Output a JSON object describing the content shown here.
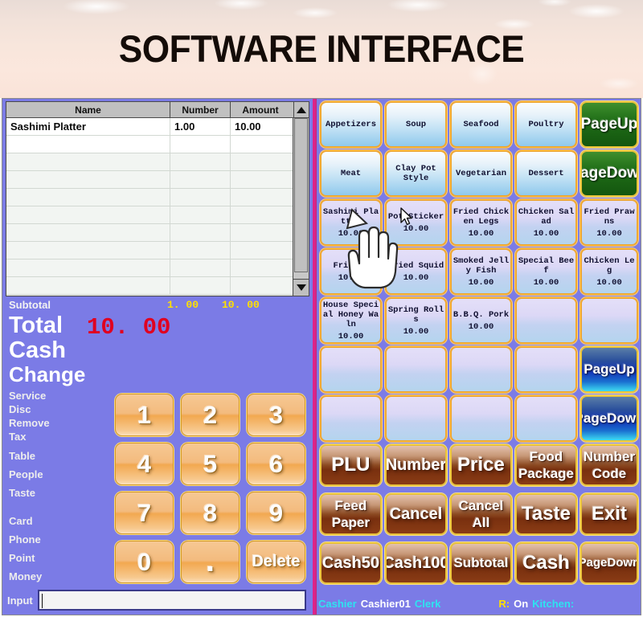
{
  "banner": {
    "title": "SOFTWARE INTERFACE"
  },
  "order_table": {
    "columns": [
      "Name",
      "Number",
      "Amount"
    ],
    "rows": [
      {
        "name": "Sashimi Platter",
        "number": "1.00",
        "amount": "10.00"
      }
    ],
    "empty_row_count": 10
  },
  "totals": {
    "subtotal_label": "Subtotal",
    "subtotal_qty": "1. 00",
    "subtotal_amount": "10. 00",
    "total_label": "Total",
    "total_value": "10. 00",
    "cash_label": "Cash",
    "cash_value": "",
    "change_label": "Change",
    "change_value": ""
  },
  "fields": [
    {
      "label": "Service",
      "value": ""
    },
    {
      "label": "Disc",
      "value": ""
    },
    {
      "label": "Remove",
      "value": ""
    },
    {
      "label": "Tax",
      "value": ""
    },
    {
      "label": "Table",
      "value": ""
    },
    {
      "label": "People",
      "value": ""
    },
    {
      "label": "Taste",
      "value": ""
    },
    {
      "label": "Card",
      "value": ""
    },
    {
      "label": "Phone",
      "value": ""
    },
    {
      "label": "Point",
      "value": ""
    },
    {
      "label": "Money",
      "value": ""
    }
  ],
  "keypad": {
    "keys": [
      "1",
      "2",
      "3",
      "4",
      "5",
      "6",
      "7",
      "8",
      "9",
      "0",
      ".",
      "Delete"
    ]
  },
  "input": {
    "label": "Input",
    "value": "",
    "placeholder": ""
  },
  "categories": [
    {
      "label": "Appetizers"
    },
    {
      "label": "Soup"
    },
    {
      "label": "Seafood"
    },
    {
      "label": "Poultry"
    },
    {
      "label": "Meat"
    },
    {
      "label": "Clay Pot Style"
    },
    {
      "label": "Vegetarian"
    },
    {
      "label": "Dessert"
    }
  ],
  "category_nav": {
    "page_up": "PageUp",
    "page_down": "PageDown"
  },
  "menu_items": [
    {
      "name": "Sashimi Platter",
      "price": "10.00"
    },
    {
      "name": "Pot Sticker",
      "price": "10.00"
    },
    {
      "name": "Fried Chicken Legs",
      "price": "10.00"
    },
    {
      "name": "Chicken Salad",
      "price": "10.00"
    },
    {
      "name": "Fried Prawns",
      "price": "10.00"
    },
    {
      "name": "Fried  s",
      "price": "10.00"
    },
    {
      "name": "Fried Squid",
      "price": "10.00"
    },
    {
      "name": "Smoked Jelly Fish",
      "price": "10.00"
    },
    {
      "name": "Special Beef",
      "price": "10.00"
    },
    {
      "name": "Chicken Leg",
      "price": "10.00"
    },
    {
      "name": "House Special Honey Waln",
      "price": "10.00"
    },
    {
      "name": "Spring Rolls",
      "price": "10.00"
    },
    {
      "name": "B.B.Q. Pork",
      "price": "10.00"
    },
    {
      "name": "",
      "price": ""
    },
    {
      "name": "",
      "price": ""
    },
    {
      "name": "",
      "price": ""
    },
    {
      "name": "",
      "price": ""
    },
    {
      "name": "",
      "price": ""
    },
    {
      "name": "",
      "price": ""
    },
    {
      "name": "",
      "price": ""
    },
    {
      "name": "",
      "price": ""
    },
    {
      "name": "",
      "price": ""
    },
    {
      "name": "",
      "price": ""
    },
    {
      "name": "",
      "price": ""
    }
  ],
  "item_nav": {
    "page_up": "PageUp",
    "page_down": "PageDown"
  },
  "function_buttons": [
    {
      "label": "PLU",
      "size": "large"
    },
    {
      "label": "Number",
      "size": "medium"
    },
    {
      "label": "Price",
      "size": "large"
    },
    {
      "label": "Food Package",
      "size": "small",
      "two_line": true
    },
    {
      "label": "Number Code",
      "size": "small",
      "two_line": true
    },
    {
      "label": "Feed Paper",
      "size": "small",
      "two_line": true
    },
    {
      "label": "Cancel",
      "size": "medium"
    },
    {
      "label": "Cancel All",
      "size": "small",
      "two_line": true
    },
    {
      "label": "Taste",
      "size": "large"
    },
    {
      "label": "Exit",
      "size": "large"
    },
    {
      "label": "Cash50",
      "size": "medium"
    },
    {
      "label": "Cash100",
      "size": "medium"
    },
    {
      "label": "Subtotal",
      "size": "small"
    },
    {
      "label": "Cash",
      "size": "large"
    },
    {
      "label": "PageDown",
      "size": "xsmall"
    }
  ],
  "status_bar": {
    "cashier_label": "Cashier",
    "cashier_value": "Cashier01",
    "clerk_label": "Clerk",
    "clerk_value": "",
    "r_label": "R:",
    "r_value": "On",
    "kitchen_label": "Kitchen:",
    "kitchen_value": ""
  },
  "colors": {
    "panel_background": "#7b7be6",
    "divider": "#e0218a",
    "total_red": "#e00020",
    "subtotal_yellow": "#ffe000",
    "keypad_orange": "#f2a850",
    "category_blue": "#8fc9ec",
    "function_brown": "#79300f",
    "page_green": "#1f6d17",
    "status_cyan": "#2ee3f0"
  }
}
